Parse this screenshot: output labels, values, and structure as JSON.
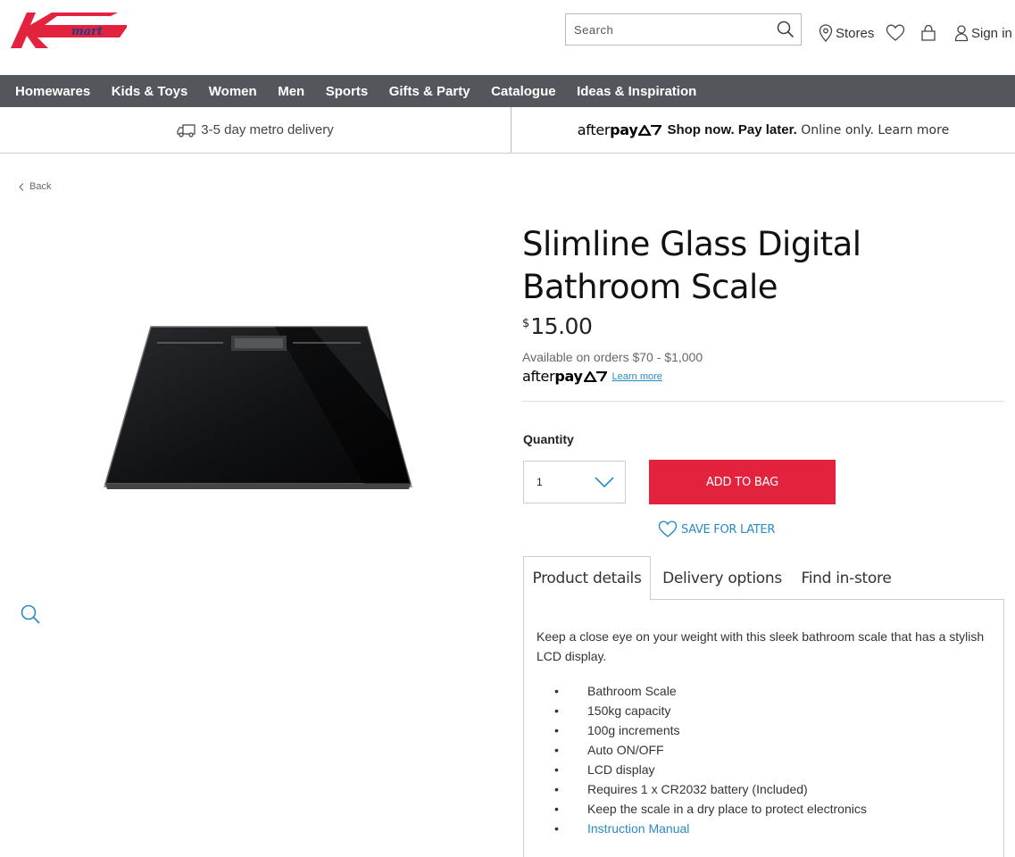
{
  "header": {
    "search_placeholder": "Search",
    "stores_label": "Stores",
    "sign_in_label": "Sign in"
  },
  "nav": {
    "items": [
      "Homewares",
      "Kids & Toys",
      "Women",
      "Men",
      "Sports",
      "Gifts & Party",
      "Catalogue",
      "Ideas & Inspiration"
    ]
  },
  "promo": {
    "delivery_text": "3-5 day metro delivery",
    "afterpay_logo_light": "after",
    "afterpay_logo_bold": "pay",
    "shop_now": "Shop now. Pay later.",
    "online_only": " Online only. Learn more"
  },
  "back_label": "Back",
  "product": {
    "title": "Slimline Glass Digital Bathroom Scale",
    "currency": "$",
    "price": "15.00",
    "availability": "Available on orders $70 - $1,000",
    "afterpay_learn_more": "Learn more",
    "quantity_label": "Quantity",
    "quantity_value": "1",
    "add_to_bag": "ADD TO BAG",
    "save_for_later": "SAVE FOR LATER"
  },
  "tabs": [
    "Product details",
    "Delivery options",
    "Find in-store"
  ],
  "details": {
    "description": "Keep a close eye on your weight with this sleek bathroom scale that has a stylish LCD display.",
    "features": [
      "Bathroom Scale",
      "150kg capacity",
      "100g increments",
      "Auto ON/OFF",
      "LCD display",
      "Requires 1 x CR2032 battery (Included)",
      "Keep the scale in a dry place to protect electronics"
    ],
    "manual_link": "Instruction Manual"
  },
  "colors": {
    "brand_red": "#e3233d",
    "nav_gray": "#53575b",
    "link_blue": "#2a8ac5"
  },
  "icons": [
    "kmart-logo",
    "search-icon",
    "location-pin-icon",
    "heart-icon",
    "bag-icon",
    "user-icon",
    "truck-icon",
    "afterpay-icon",
    "chevron-left-icon",
    "chevron-down-icon",
    "zoom-icon"
  ]
}
